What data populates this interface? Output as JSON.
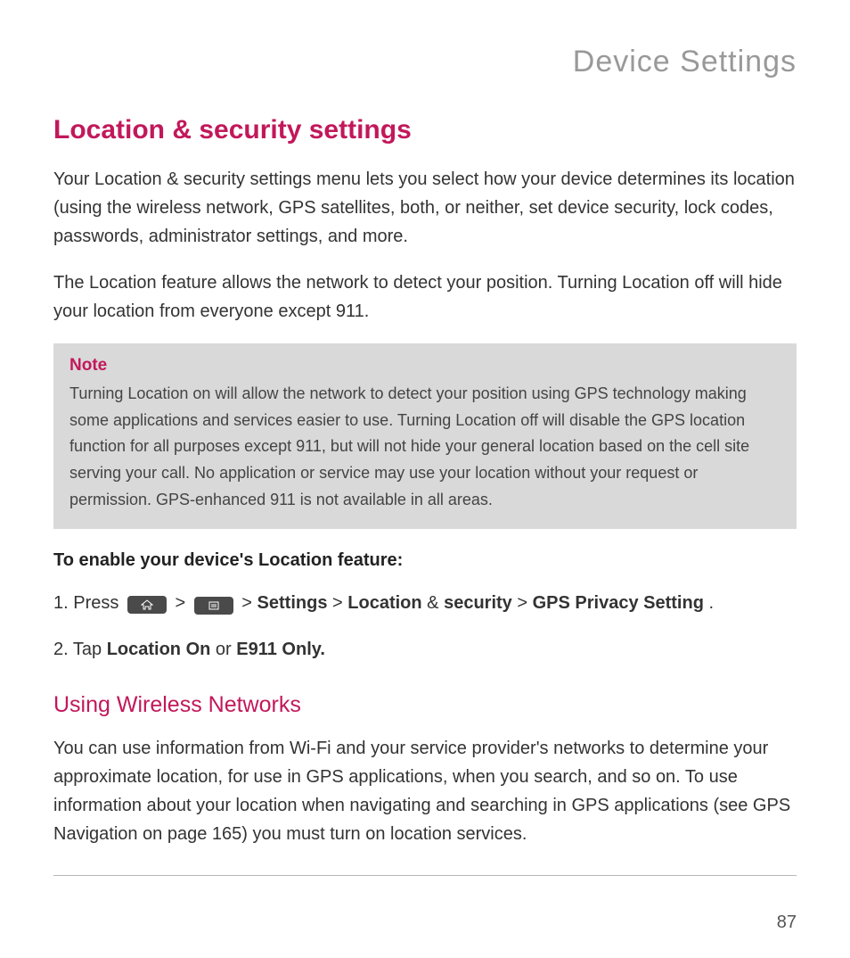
{
  "chapter": "Device Settings",
  "h1": "Location & security settings",
  "p1": "Your Location & security settings menu lets you select how your device determines its location (using the wireless network, GPS satellites, both, or neither, set device security, lock codes, passwords, administrator settings, and more.",
  "p2": "The Location feature allows the network to detect your position. Turning Location off will hide your location from everyone except 911.",
  "note": {
    "title": "Note",
    "body": "Turning Location on will allow the network to detect your position using GPS technology making some applications and services easier to use. Turning Location off will disable the GPS location function for all purposes except 911, but will not hide your general location based on the cell site serving your call. No application or service may use your location without your request or permission. GPS-enhanced 911 is not available in all areas."
  },
  "enable_heading": "To enable your device's Location feature:",
  "step1": {
    "prefix": "1. Press ",
    "gt1": " > ",
    "gt2": " > ",
    "settings": "Settings",
    "sep1": " > ",
    "location": "Location",
    "amp": " & ",
    "security": "security",
    "sep2": " > ",
    "gps": "GPS Privacy Setting",
    "period": "."
  },
  "step2": {
    "prefix": "2. Tap ",
    "location_on": "Location On",
    "or": " or ",
    "e911": "E911 Only."
  },
  "h2": "Using Wireless Networks",
  "p3": "You can use information from Wi-Fi and your service provider's networks to determine your approximate location, for use in GPS applications, when you search, and so on. To use information about your location when navigating and searching in GPS applications (see GPS Navigation on page 165) you must turn on location services.",
  "page": "87"
}
